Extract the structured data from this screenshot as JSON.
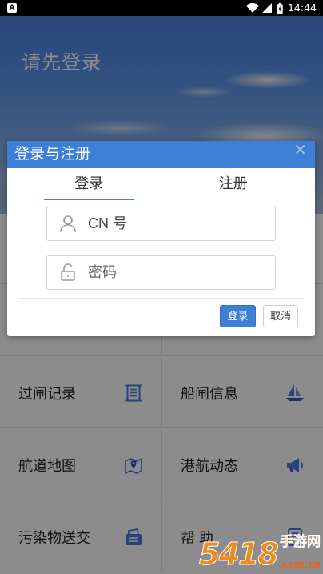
{
  "status_bar": {
    "notification_glyph": "A",
    "notification_icon": "app-notification-icon",
    "time": "14:44",
    "icons": [
      "wifi-icon",
      "signal-icon",
      "battery-charging-icon"
    ]
  },
  "header": {
    "title": "请先登录"
  },
  "menu": {
    "items": [
      {
        "label": "过闸记录",
        "icon": "receipt-icon"
      },
      {
        "label": "船闸信息",
        "icon": "sailboat-icon"
      },
      {
        "label": "航道地图",
        "icon": "map-pin-icon"
      },
      {
        "label": "港航动态",
        "icon": "megaphone-icon"
      },
      {
        "label": "污染物送交",
        "icon": "document-stack-icon"
      },
      {
        "label": "帮 助",
        "icon": "help-document-icon"
      }
    ]
  },
  "dialog": {
    "title": "登录与注册",
    "close_glyph": "×",
    "tabs": [
      {
        "label": "登录",
        "active": true
      },
      {
        "label": "注册",
        "active": false
      }
    ],
    "fields": {
      "username": {
        "placeholder": "CN 号",
        "icon": "user-icon"
      },
      "password": {
        "placeholder": "密码",
        "icon": "lock-icon"
      }
    },
    "buttons": {
      "confirm": "登录",
      "cancel": "取消"
    }
  },
  "watermark": {
    "digits": "5418",
    "brand": "手游网",
    "domain": ".com.cn"
  },
  "colors": {
    "accent": "#3d7fd5",
    "status_bar": "#000000",
    "menu_icon": "#4d7be6",
    "watermark": "#f08a1c"
  }
}
